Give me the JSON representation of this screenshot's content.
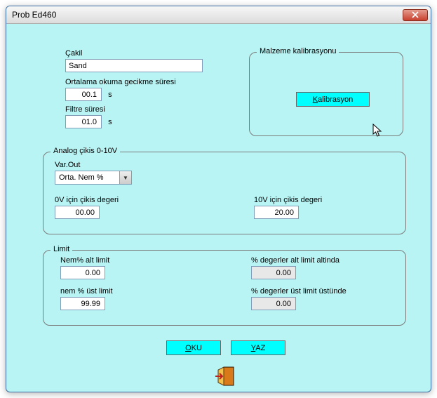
{
  "window": {
    "title": "Prob Ed460"
  },
  "topleft": {
    "cakil_label": "Çakil",
    "cakil_value": "Sand",
    "delay_label": "Ortalama okuma gecikme süresi",
    "delay_value": "00.1",
    "delay_unit": "s",
    "filter_label": "Filtre süresi",
    "filter_value": "01.0",
    "filter_unit": "s"
  },
  "calibration": {
    "legend": "Malzeme kalibrasyonu",
    "button_label": "Kalibrasyon"
  },
  "analog": {
    "legend": "Analog çikis 0-10V",
    "varout_label": "Var.Out",
    "varout_value": "Orta. Nem %",
    "zero_label": "0V için çikis degeri",
    "zero_value": "00.00",
    "ten_label": "10V için çikis degeri",
    "ten_value": "20.00"
  },
  "limit": {
    "legend": "Limit",
    "nem_alt_label": "Nem% alt limit",
    "nem_alt_value": "0.00",
    "pct_alt_label": "% degerler alt limit altinda",
    "pct_alt_value": "0.00",
    "nem_ust_label": "nem % üst limit",
    "nem_ust_value": "99.99",
    "pct_ust_label": "% degerler üst limit üstünde",
    "pct_ust_value": "0.00"
  },
  "buttons": {
    "oku": "OKU",
    "yaz": "YAZ"
  }
}
